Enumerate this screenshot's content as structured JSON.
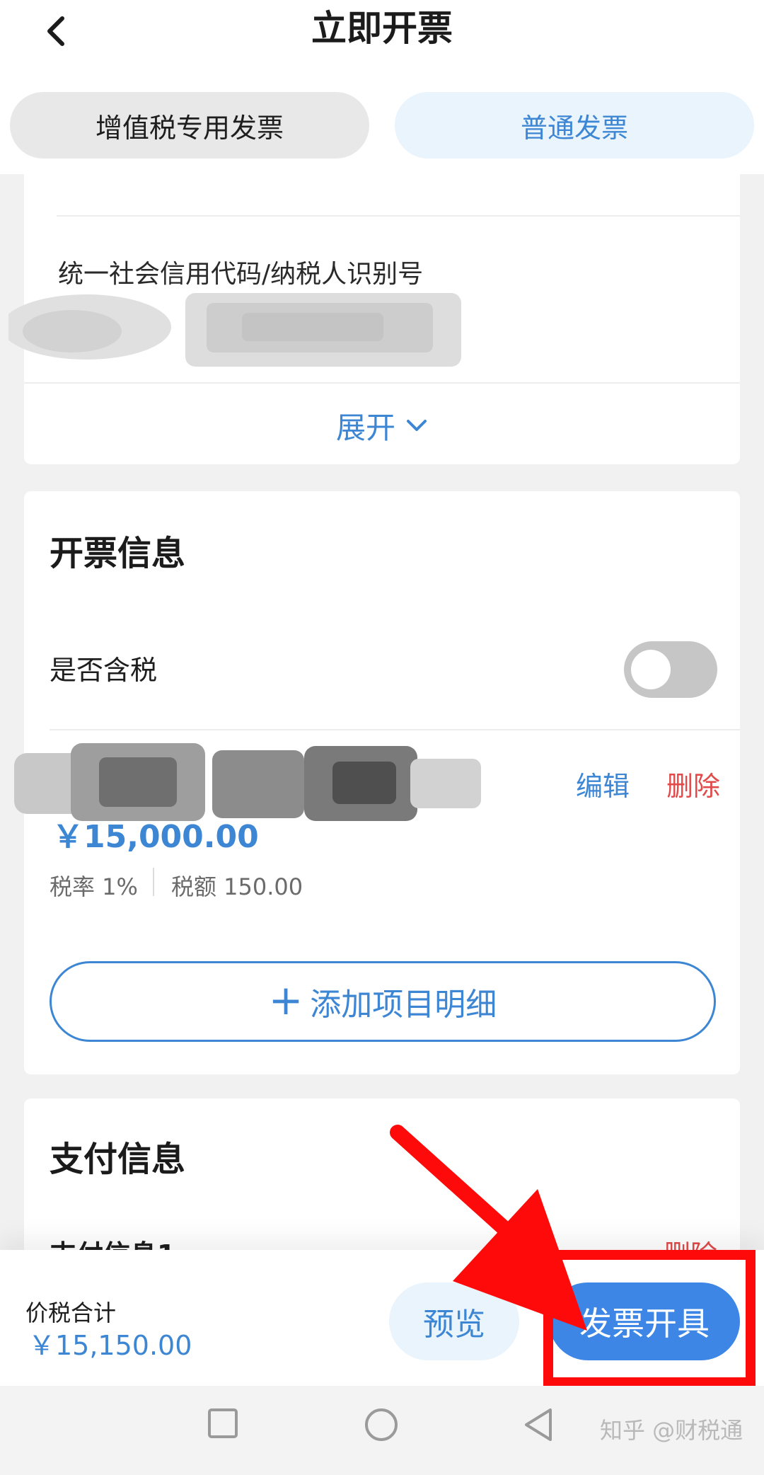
{
  "header": {
    "title": "立即开票",
    "back_icon": "chevron-left-icon"
  },
  "tabs": [
    {
      "label": "增值税专用发票",
      "active": false
    },
    {
      "label": "普通发票",
      "active": true
    }
  ],
  "buyer_card": {
    "credit_code_label": "统一社会信用代码/纳税人识别号",
    "expand_label": "展开",
    "expand_icon": "chevron-down-icon"
  },
  "invoice_info": {
    "title": "开票信息",
    "tax_included_label": "是否含税",
    "tax_included": false,
    "item": {
      "edit_label": "编辑",
      "delete_label": "删除",
      "amount": "￥15,000.00",
      "tax_rate": "税率 1%",
      "tax_amount": "税额 150.00"
    },
    "add_item_label": "添加项目明细"
  },
  "payment_info": {
    "title": "支付信息",
    "item_label": "支付信息1",
    "delete_label": "删除"
  },
  "bottom_bar": {
    "total_label": "价税合计",
    "total_value": "￥15,150.00",
    "preview_label": "预览",
    "issue_label": "发票开具"
  },
  "watermark": "知乎 @财税通",
  "colors": {
    "accent": "#3d86d3",
    "primary_button": "#3d86e6",
    "danger": "#e24a4a",
    "annotation_red": "#ff0a0a"
  }
}
